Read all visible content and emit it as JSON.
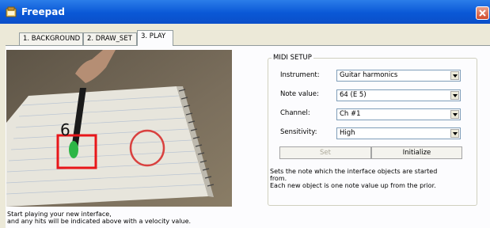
{
  "window": {
    "title": "Freepad",
    "close_icon": "close-icon"
  },
  "tabs": [
    {
      "label": "1. BACKGROUND",
      "active": false
    },
    {
      "label": "2. DRAW_SET",
      "active": false
    },
    {
      "label": "3. PLAY",
      "active": true
    }
  ],
  "video": {
    "velocity_value": "6"
  },
  "play_hint": {
    "line1": "Start playing your new interface,",
    "line2": "and any hits will be indicated above with a velocity value."
  },
  "midi": {
    "legend": "MIDI SETUP",
    "instrument_label": "Instrument:",
    "instrument_value": "Guitar harmonics",
    "note_label": "Note value:",
    "note_value": "64 (E 5)",
    "channel_label": "Channel:",
    "channel_value": "Ch #1",
    "sensitivity_label": "Sensitivity:",
    "sensitivity_value": "High",
    "set_label": "Set",
    "initialize_label": "Initialize",
    "desc_line1": "Sets the note which the interface objects are started",
    "desc_line2": "from.",
    "desc_line3": "Each new object is one note value up from the prior."
  },
  "colors": {
    "title_bar": "#0a58d6",
    "detect_box": "#e8161a",
    "circle": "#d9413f"
  }
}
